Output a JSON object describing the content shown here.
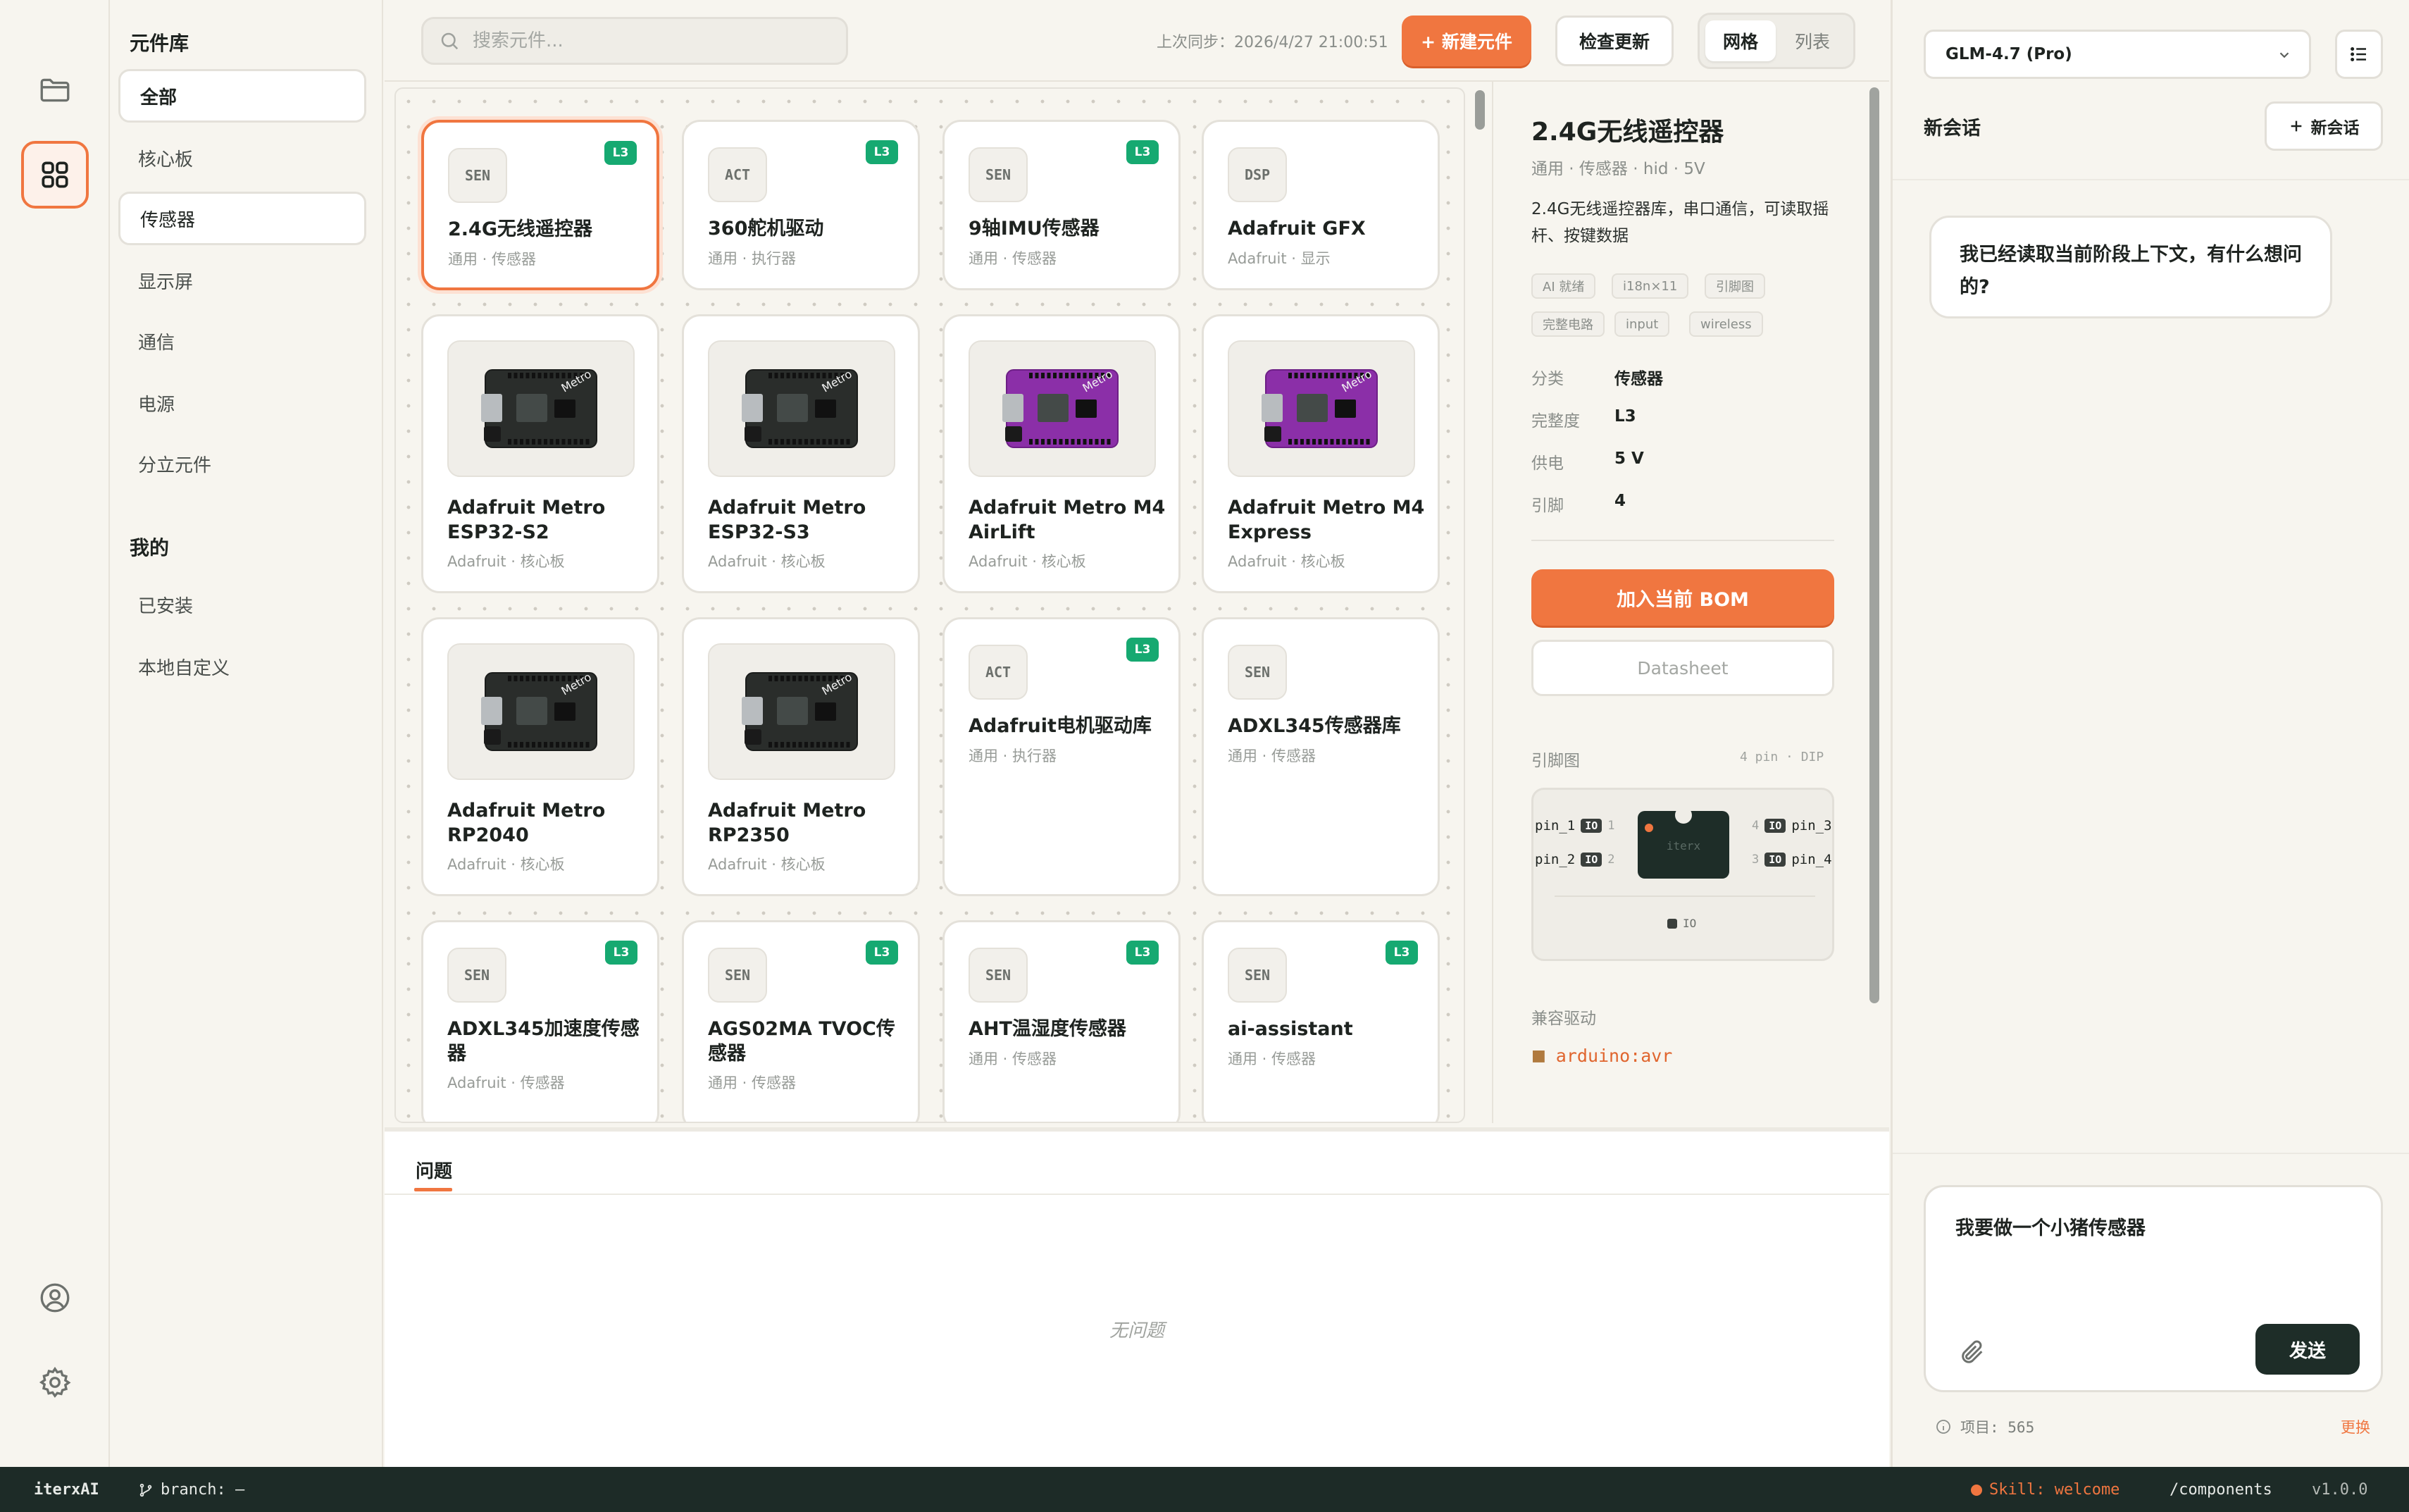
{
  "rail": {
    "items": [
      "folder-icon",
      "components-icon",
      "account-icon",
      "settings-icon"
    ]
  },
  "library": {
    "title": "元件库",
    "categories": [
      "全部",
      "核心板",
      "传感器",
      "显示屏",
      "通信",
      "电源",
      "分立元件"
    ],
    "mine_title": "我的",
    "mine": [
      "已安装",
      "本地自定义"
    ]
  },
  "toolbar": {
    "search_placeholder": "搜索元件...",
    "last_sync": "上次同步：2026/4/27 21:00:51",
    "new_component": "+ 新建元件",
    "check_update": "检查更新",
    "view_grid": "网格",
    "view_list": "列表"
  },
  "cards": [
    {
      "badge": "SEN",
      "level": "L3",
      "title": "2.4G无线遥控器",
      "sub": "通用 · 传感器"
    },
    {
      "badge": "ACT",
      "level": "L3",
      "title": "360舵机驱动",
      "sub": "通用 · 执行器"
    },
    {
      "badge": "SEN",
      "level": "L3",
      "title": "9轴IMU传感器",
      "sub": "通用 · 传感器"
    },
    {
      "badge": "DSP",
      "level": "",
      "title": "Adafruit GFX",
      "sub": "Adafruit · 显示"
    },
    {
      "board": "dark",
      "title": "Adafruit Metro ESP32-S2",
      "sub": "Adafruit · 核心板"
    },
    {
      "board": "dark",
      "title": "Adafruit Metro ESP32-S3",
      "sub": "Adafruit · 核心板"
    },
    {
      "board": "purple",
      "title": "Adafruit Metro M4 AirLift",
      "sub": "Adafruit · 核心板"
    },
    {
      "board": "purple",
      "title": "Adafruit Metro M4 Express",
      "sub": "Adafruit · 核心板"
    },
    {
      "board": "dark",
      "title": "Adafruit Metro RP2040",
      "sub": "Adafruit · 核心板"
    },
    {
      "board": "dark",
      "title": "Adafruit Metro RP2350",
      "sub": "Adafruit · 核心板"
    },
    {
      "badge": "ACT",
      "level": "L3",
      "title": "Adafruit电机驱动库",
      "sub": "通用 · 执行器"
    },
    {
      "badge": "SEN",
      "level": "",
      "title": "ADXL345传感器库",
      "sub": "通用 · 传感器"
    },
    {
      "badge": "SEN",
      "level": "L3",
      "title": "ADXL345加速度传感器",
      "sub": "Adafruit · 传感器"
    },
    {
      "badge": "SEN",
      "level": "L3",
      "title": "AGS02MA TVOC传感器",
      "sub": "通用 · 传感器"
    },
    {
      "badge": "SEN",
      "level": "L3",
      "title": "AHT温湿度传感器",
      "sub": "通用 · 传感器"
    },
    {
      "badge": "SEN",
      "level": "L3",
      "title": "ai-assistant",
      "sub": "通用 · 传感器"
    }
  ],
  "detail": {
    "title": "2.4G无线遥控器",
    "subtitle": "通用 · 传感器 · hid · 5V",
    "description": "2.4G无线遥控器库，串口通信，可读取摇杆、按键数据",
    "tags": [
      "AI 就绪",
      "i18n×11",
      "引脚图",
      "完整电路",
      "input",
      "wireless"
    ],
    "props": [
      {
        "k": "分类",
        "v": "传感器"
      },
      {
        "k": "完整度",
        "v": "L3"
      },
      {
        "k": "供电",
        "v": "5 V"
      },
      {
        "k": "引脚",
        "v": "4"
      }
    ],
    "add_bom": "加入当前 BOM",
    "datasheet": "Datasheet",
    "pinout_label": "引脚图",
    "pinout_meta": "4 pin · DIP",
    "chip_label": "iterx",
    "pins_left": [
      {
        "name": "pin_1",
        "type": "IO",
        "num": "1"
      },
      {
        "name": "pin_2",
        "type": "IO",
        "num": "2"
      }
    ],
    "pins_right": [
      {
        "name": "pin_3",
        "type": "IO",
        "num": "4"
      },
      {
        "name": "pin_4",
        "type": "IO",
        "num": "3"
      }
    ],
    "legend": "IO",
    "drivers_label": "兼容驱动",
    "driver": "arduino:avr"
  },
  "problems": {
    "tab": "问题",
    "empty": "无问题"
  },
  "chat": {
    "model": "GLM-4.7 (Pro)",
    "session": "新会话",
    "new_session": "新会话",
    "assistant_msg": "我已经读取当前阶段上下文，有什么想问的?",
    "input_value": "我要做一个小猪传感器",
    "send": "发送",
    "project": "项目: 565",
    "change": "更换"
  },
  "statusbar": {
    "app": "iterxAI",
    "branch": "branch: —",
    "skill": "Skill: welcome",
    "route": "/components",
    "version": "v1.0.0"
  },
  "colors": {
    "accent": "#f07640",
    "level": "#16a971",
    "statusbar": "#1d2b27"
  }
}
